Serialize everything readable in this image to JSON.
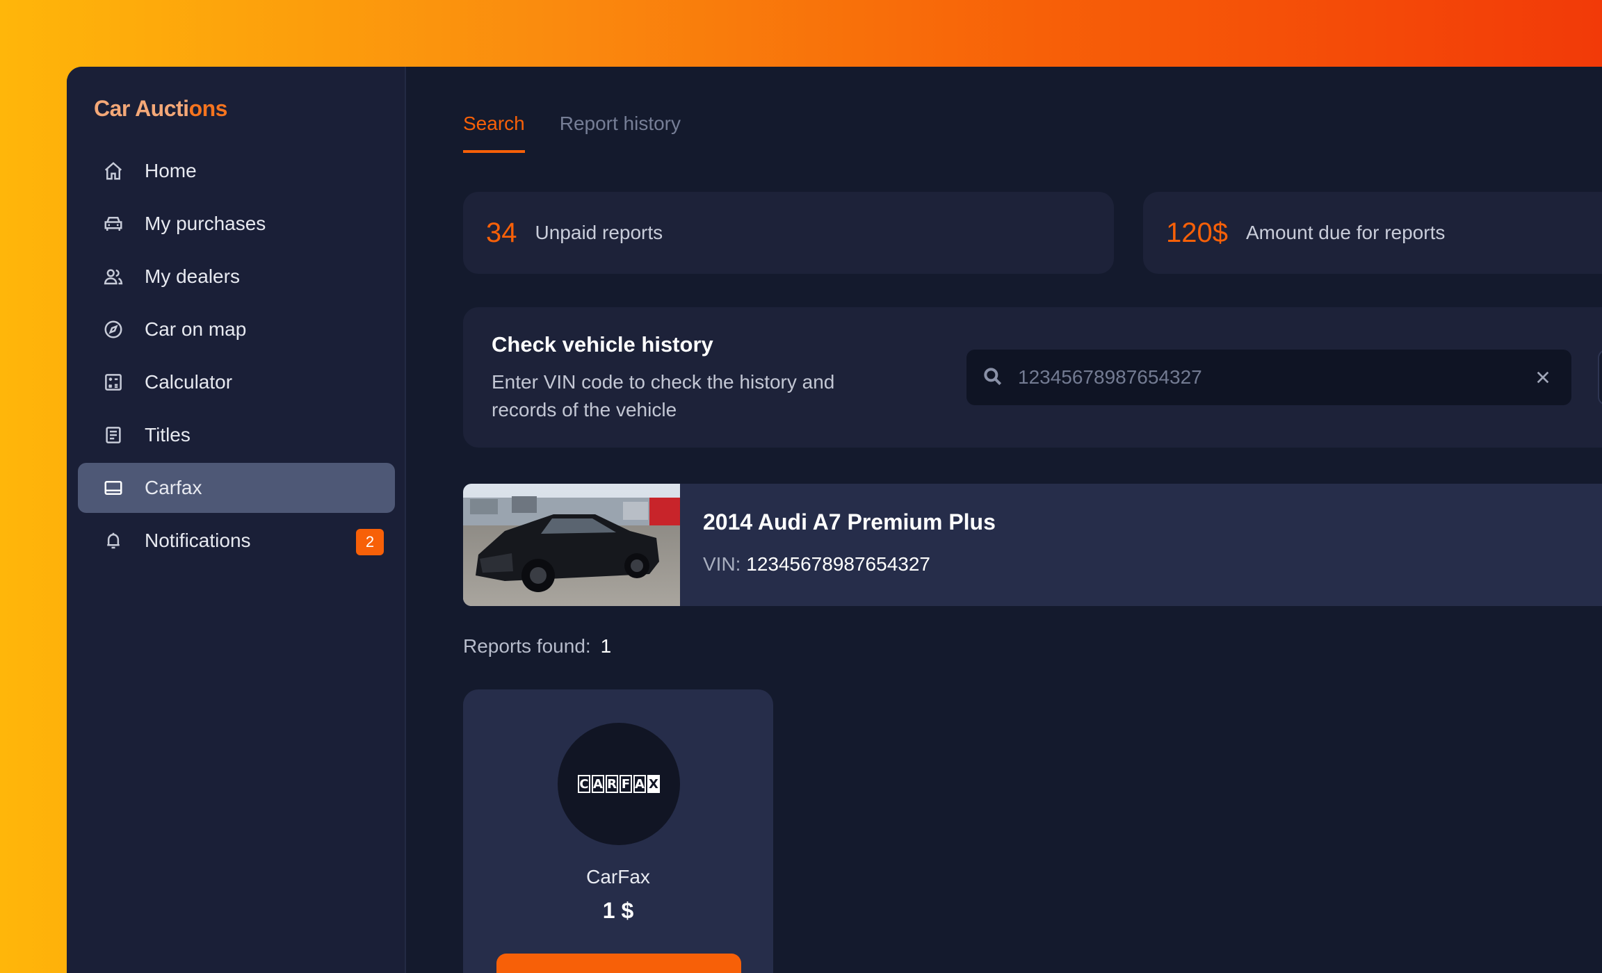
{
  "brand": {
    "part1": "Car Aucti",
    "part2": "ons"
  },
  "sidebar": {
    "items": [
      {
        "label": "Home",
        "icon": "home-icon"
      },
      {
        "label": "My purchases",
        "icon": "car-icon"
      },
      {
        "label": "My dealers",
        "icon": "users-icon"
      },
      {
        "label": "Car on map",
        "icon": "compass-icon"
      },
      {
        "label": "Calculator",
        "icon": "calculator-icon"
      },
      {
        "label": "Titles",
        "icon": "document-icon"
      },
      {
        "label": "Carfax",
        "icon": "card-icon",
        "active": true
      },
      {
        "label": "Notifications",
        "icon": "bell-icon",
        "badge": "2"
      }
    ]
  },
  "tabs": [
    {
      "label": "Search",
      "active": true
    },
    {
      "label": "Report history",
      "active": false
    }
  ],
  "stats": {
    "unpaid": {
      "value": "34",
      "label": "Unpaid reports"
    },
    "due": {
      "value": "120$",
      "label": "Amount due for reports"
    }
  },
  "check": {
    "title": "Check vehicle history",
    "description": "Enter VIN code to check the history and records of the vehicle",
    "search_value": "12345678987654327"
  },
  "vehicle": {
    "title": "2014 Audi A7 Premium Plus",
    "vin_label": "VIN:",
    "vin": "12345678987654327"
  },
  "reports": {
    "found_label": "Reports found:",
    "found_count": "1",
    "items": [
      {
        "name": "CarFax",
        "price": "1 $",
        "logo": "CARFAX"
      }
    ]
  },
  "colors": {
    "accent": "#F76008",
    "background": "#141A2D",
    "sidebar": "#1A1F37",
    "card": "#1D2239"
  }
}
